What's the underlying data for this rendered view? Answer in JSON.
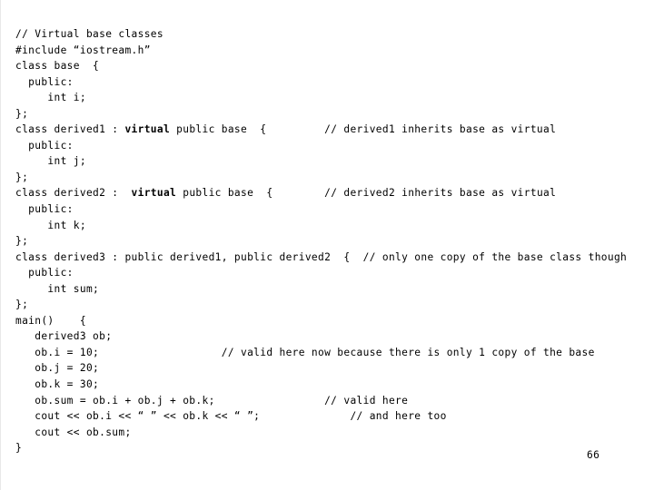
{
  "slide": {
    "page_number": "66",
    "background_color": "#ffffff",
    "text_color": "#000000",
    "code_lines": [
      {
        "id": "line-1",
        "text": "// Virtual base classes"
      },
      {
        "id": "line-2",
        "text": "#include “iostream.h”"
      },
      {
        "id": "line-3",
        "text": "class base  {"
      },
      {
        "id": "line-4",
        "text": "  public:"
      },
      {
        "id": "line-5",
        "text": "     int i;"
      },
      {
        "id": "line-6",
        "text": "};"
      },
      {
        "id": "line-7",
        "pre": "class derived1 : ",
        "bold": "virtual",
        "post": " public base  {         // derived1 inherits base as virtual"
      },
      {
        "id": "line-8",
        "text": "  public:"
      },
      {
        "id": "line-9",
        "text": "     int j;"
      },
      {
        "id": "line-10",
        "text": "};"
      },
      {
        "id": "line-11",
        "pre": "class derived2 :  ",
        "bold": "virtual",
        "post": " public base  {        // derived2 inherits base as virtual"
      },
      {
        "id": "line-12",
        "text": "  public:"
      },
      {
        "id": "line-13",
        "text": "     int k;"
      },
      {
        "id": "line-14",
        "text": "};"
      },
      {
        "id": "line-15",
        "text": "class derived3 : public derived1, public derived2  {  // only one copy of the base class though"
      },
      {
        "id": "line-16",
        "text": "  public:"
      },
      {
        "id": "line-17",
        "text": "     int sum;"
      },
      {
        "id": "line-18",
        "text": "};"
      },
      {
        "id": "line-19",
        "text": "main()    {"
      },
      {
        "id": "line-20",
        "text": "   derived3 ob;"
      },
      {
        "id": "line-21",
        "text": "   ob.i = 10;                   // valid here now because there is only 1 copy of the base"
      },
      {
        "id": "line-22",
        "text": "   ob.j = 20;"
      },
      {
        "id": "line-23",
        "text": "   ob.k = 30;"
      },
      {
        "id": "line-24",
        "text": "   ob.sum = ob.i + ob.j + ob.k;                 // valid here"
      },
      {
        "id": "line-25",
        "text": "   cout << ob.i << “ ” << ob.k << “ ”;              // and here too"
      },
      {
        "id": "line-26",
        "text": "   cout << ob.sum;"
      },
      {
        "id": "line-27",
        "text": "}"
      }
    ]
  }
}
